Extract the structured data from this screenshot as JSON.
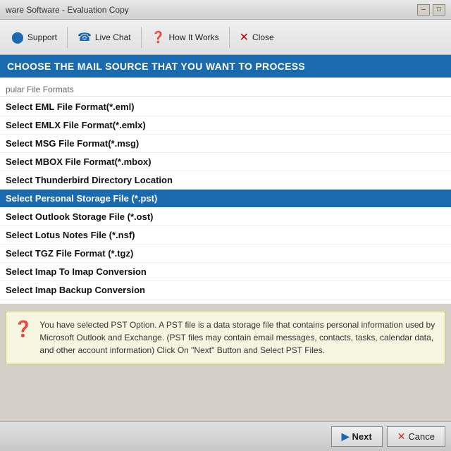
{
  "titleBar": {
    "title": "ware Software - Evaluation Copy",
    "minimizeLabel": "–",
    "maximizeLabel": "□"
  },
  "toolbar": {
    "items": [
      {
        "id": "support",
        "icon": "⬤",
        "iconType": "circle",
        "label": "Support"
      },
      {
        "id": "live-chat",
        "icon": "📞",
        "label": "Live Chat"
      },
      {
        "id": "how-it-works",
        "icon": "❓",
        "label": "How It Works"
      },
      {
        "id": "close",
        "icon": "✕",
        "label": "Close"
      }
    ]
  },
  "headerBar": {
    "text": "CHOOSE THE MAIL SOURCE THAT YOU WANT TO PROCESS"
  },
  "fileFormats": {
    "sectionLabel": "pular File Formats",
    "items": [
      {
        "id": "eml",
        "label": "Select EML File Format(*.eml)",
        "selected": false
      },
      {
        "id": "emlx",
        "label": "Select EMLX File Format(*.emlx)",
        "selected": false
      },
      {
        "id": "msg",
        "label": "Select MSG File Format(*.msg)",
        "selected": false
      },
      {
        "id": "mbox",
        "label": "Select MBOX File Format(*.mbox)",
        "selected": false
      },
      {
        "id": "thunderbird",
        "label": "Select Thunderbird Directory Location",
        "selected": false
      },
      {
        "id": "pst",
        "label": "Select Personal Storage File (*.pst)",
        "selected": true
      },
      {
        "id": "ost",
        "label": "Select Outlook Storage File (*.ost)",
        "selected": false
      },
      {
        "id": "nsf",
        "label": "Select Lotus Notes File (*.nsf)",
        "selected": false
      },
      {
        "id": "tgz",
        "label": "Select TGZ File Format (*.tgz)",
        "selected": false
      },
      {
        "id": "imap-conversion",
        "label": "Select Imap To Imap Conversion",
        "selected": false
      },
      {
        "id": "imap-backup",
        "label": "Select Imap Backup Conversion",
        "selected": false
      }
    ]
  },
  "infoBox": {
    "text": "You have selected PST Option. A PST file is a data storage file that contains personal information used by Microsoft Outlook and Exchange. (PST files may contain email messages, contacts, tasks, calendar data, and other account information) Click On \"Next\" Button and Select PST Files."
  },
  "bottomBar": {
    "nextLabel": "Next",
    "cancelLabel": "Cance"
  }
}
